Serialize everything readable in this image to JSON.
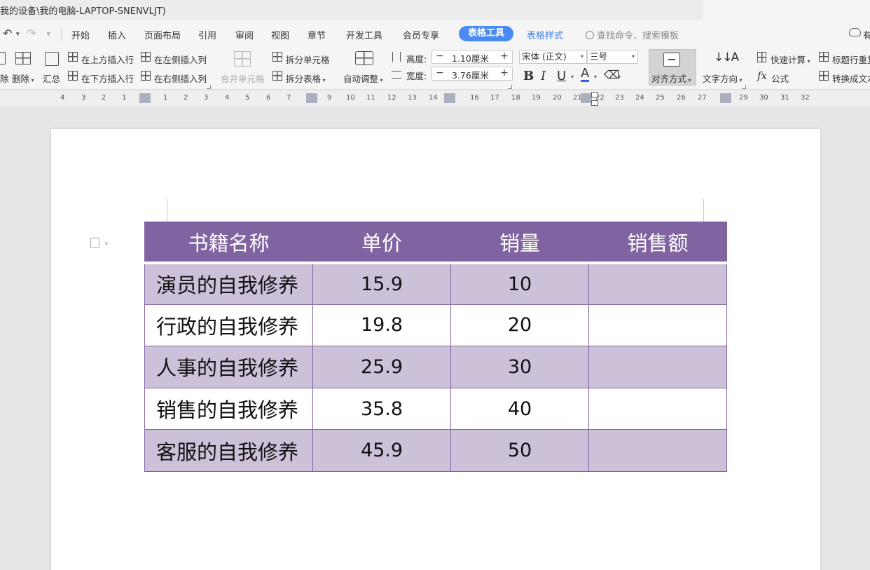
{
  "window": {
    "title_path": "我的设备\\我的电脑-LAPTOP-SNENVLJT)"
  },
  "quick_access": {
    "undo_icon": "undo-icon",
    "redo_icon": "redo-icon",
    "more_icon": "dropdown-icon"
  },
  "tabs": [
    {
      "label": "开始"
    },
    {
      "label": "插入"
    },
    {
      "label": "页面布局"
    },
    {
      "label": "引用"
    },
    {
      "label": "审阅"
    },
    {
      "label": "视图"
    },
    {
      "label": "章节"
    },
    {
      "label": "开发工具"
    },
    {
      "label": "会员专享"
    },
    {
      "label": "表格工具",
      "active": true
    },
    {
      "label": "表格样式"
    }
  ],
  "search": {
    "label": "查找命令、搜索模板"
  },
  "cloud": {
    "label": "有"
  },
  "ribbon": {
    "delete_cut": "除",
    "delete_label": "删除",
    "summary_label": "汇总",
    "insert_above": "在上方插入行",
    "insert_below": "在下方插入行",
    "insert_left": "在左侧插入列",
    "insert_right": "在右侧插入列",
    "merge_cells": "合并单元格",
    "split_cells": "拆分单元格",
    "split_table": "拆分表格",
    "auto_adjust": "自动调整",
    "height_label": "高度:",
    "height_value": "1.10厘米",
    "width_label": "宽度:",
    "width_value": "3.76厘米",
    "minus": "−",
    "plus": "+",
    "font_name": "宋体 (正文)",
    "font_size": "三号",
    "bold": "B",
    "italic": "I",
    "underline": "U",
    "font_color": "A",
    "align_label": "对齐方式",
    "text_direction": "文字方向",
    "quick_calc": "快速计算",
    "formula": "公式",
    "formula_icon": "fx",
    "header_repeat": "标题行重复",
    "convert_text": "转换成文本"
  },
  "ruler": [
    "4",
    "3",
    "2",
    "1",
    "1",
    "2",
    "3",
    "4",
    "5",
    "6",
    "7",
    "9",
    "10",
    "11",
    "12",
    "13",
    "14",
    "16",
    "17",
    "18",
    "19",
    "20",
    "21",
    "22",
    "23",
    "24",
    "25",
    "26",
    "27",
    "29",
    "30",
    "31",
    "32"
  ],
  "table": {
    "headers": [
      "书籍名称",
      "单价",
      "销量",
      "销售额"
    ],
    "rows": [
      {
        "name": "演员的自我修养",
        "price": "15.9",
        "qty": "10",
        "sales": ""
      },
      {
        "name": "行政的自我修养",
        "price": "19.8",
        "qty": "20",
        "sales": ""
      },
      {
        "name": "人事的自我修养",
        "price": "25.9",
        "qty": "30",
        "sales": ""
      },
      {
        "name": "销售的自我修养",
        "price": "35.8",
        "qty": "40",
        "sales": ""
      },
      {
        "name": "客服的自我修养",
        "price": "45.9",
        "qty": "50",
        "sales": ""
      }
    ]
  },
  "colors": {
    "header_bg": "#8064a2",
    "band_bg": "#cdc1d9",
    "active_tab": "#4a8af4",
    "link_tab": "#3c7ff0"
  }
}
